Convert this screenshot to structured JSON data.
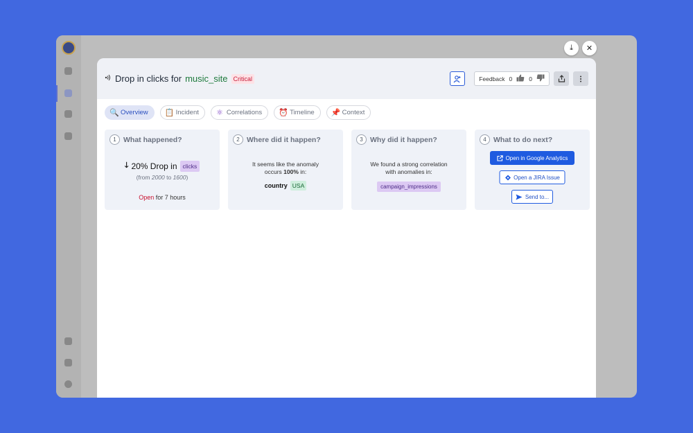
{
  "window_controls": {
    "download_glyph": "⤓",
    "close_glyph": "✕"
  },
  "header": {
    "title_prefix": "Drop in clicks for",
    "entity": "music_site",
    "severity": "Critical",
    "feedback_label": "Feedback",
    "likes": "0",
    "dislikes": "0"
  },
  "tabs": [
    {
      "label": "Overview",
      "icon": "magnifier-icon",
      "glyph": "🔍"
    },
    {
      "label": "Incident",
      "icon": "clipboard-icon",
      "glyph": "📋"
    },
    {
      "label": "Correlations",
      "icon": "atom-icon",
      "glyph": "⚛"
    },
    {
      "label": "Timeline",
      "icon": "alarm-clock-icon",
      "glyph": "⏰"
    },
    {
      "label": "Context",
      "icon": "pushpin-icon",
      "glyph": "📌"
    }
  ],
  "cards": [
    {
      "number": "1",
      "title": "What happened?",
      "arrow": "🡓",
      "change": "20% Drop in",
      "metric": "clicks",
      "range_prefix": "(from ",
      "range_from": "2000",
      "range_mid": " to ",
      "range_to": "1600",
      "range_suffix": ")",
      "status": "Open",
      "duration": "for 7 hours"
    },
    {
      "number": "2",
      "title": "Where did it happen?",
      "line1": "It seems like the anomaly",
      "line2_prefix": "occurs ",
      "line2_pct": "100%",
      "line2_suffix": " in:",
      "dimension": "country",
      "value": "USA"
    },
    {
      "number": "3",
      "title": "Why did it happen?",
      "line1": "We found a strong correlation",
      "line2": "with anomalies in:",
      "correlated_metric": "campaign_impressions"
    },
    {
      "number": "4",
      "title": "What to do next?",
      "btn_analytics": "Open in Google Analytics",
      "btn_jira": "Open a JIRA Issue",
      "btn_send": "Send to..."
    }
  ],
  "colors": {
    "background": "#4168e0",
    "accent": "#1f5be0",
    "critical": "#c81e3a",
    "entity": "#1e7a3c"
  }
}
